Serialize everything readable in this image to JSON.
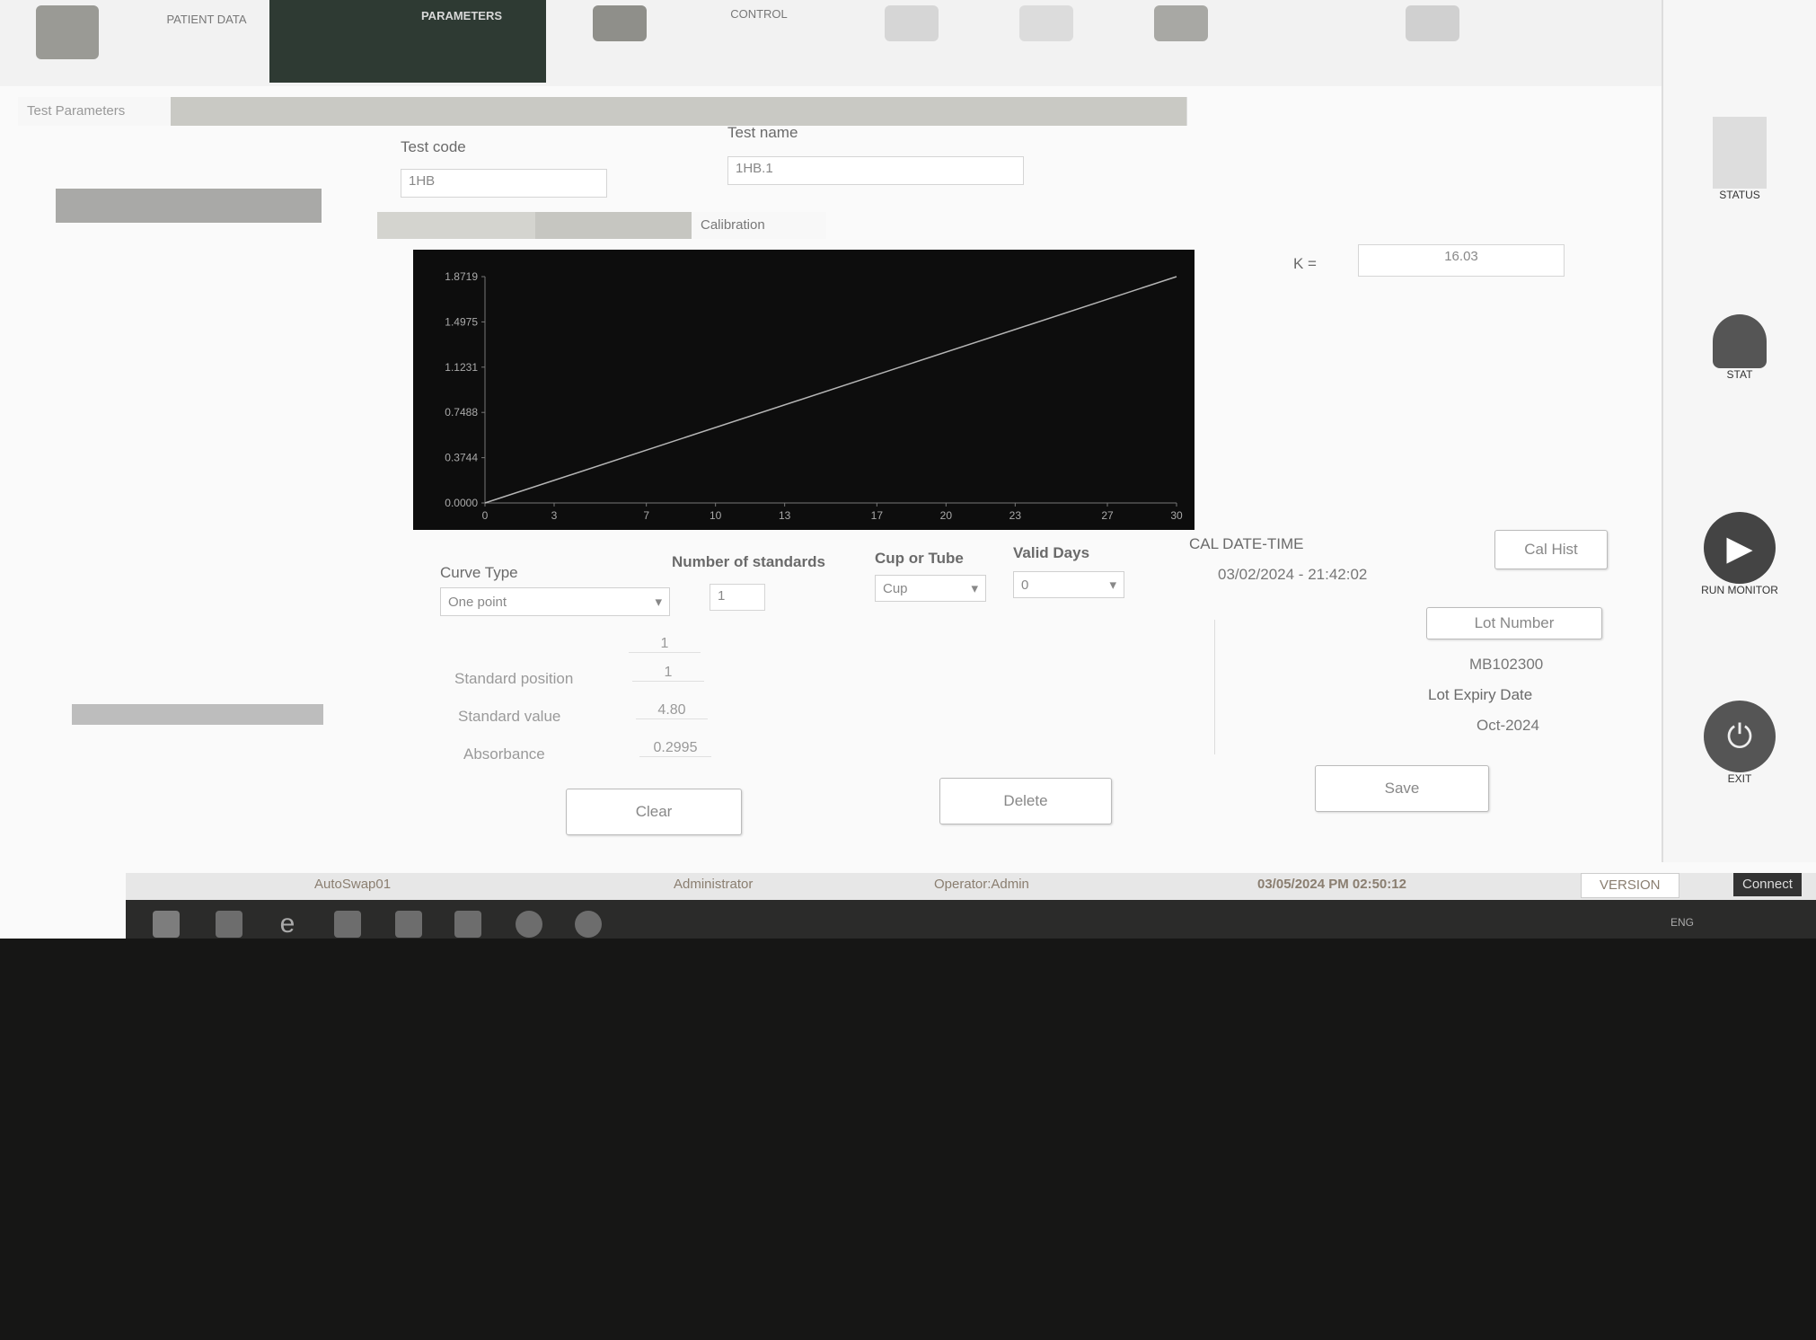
{
  "toolbar": {
    "items": [
      "PATIENT DATA",
      "PARAMETERS",
      "",
      "CONTROL",
      "",
      "",
      "",
      ""
    ]
  },
  "tabs": [
    "Test Parameters",
    "",
    "",
    "",
    "",
    "",
    "",
    "",
    ""
  ],
  "left_panel": {
    "tests": [
      "",
      "",
      "",
      "",
      "",
      "",
      "",
      "",
      "",
      "",
      "",
      "",
      "",
      "",
      "",
      "",
      "",
      "",
      "",
      "",
      "",
      "",
      "",
      "",
      "",
      "",
      "",
      "",
      ""
    ],
    "selected_index": 22
  },
  "test_code": {
    "label": "Test code",
    "value": "1HB"
  },
  "test_name": {
    "label": "Test name",
    "value": "1HB.1"
  },
  "subtabs": [
    "",
    "",
    "Calibration"
  ],
  "k": {
    "label": "K =",
    "value": "16.03"
  },
  "chart_data": {
    "type": "line",
    "y_ticks": [
      "0.0000",
      "0.3744",
      "0.7488",
      "1.1231",
      "1.4975",
      "1.8719"
    ],
    "x_ticks": [
      "0",
      "3",
      "7",
      "10",
      "13",
      "17",
      "20",
      "23",
      "27",
      "30"
    ],
    "ylim": [
      0,
      1.8719
    ],
    "xlim": [
      0,
      30
    ],
    "series": [
      {
        "x": [
          0,
          30
        ],
        "values": [
          0,
          1.8719
        ]
      }
    ],
    "line_color": "#b5b5b5",
    "background": "#0d0d0d"
  },
  "curve_type": {
    "label": "Curve Type",
    "value": "One point"
  },
  "num_standards": {
    "label": "Number of standards",
    "value": "1"
  },
  "cup_tube": {
    "label": "Cup or Tube",
    "value": "Cup"
  },
  "valid_days": {
    "label": "Valid Days",
    "value": "0"
  },
  "cal": {
    "label": "CAL DATE-TIME",
    "value": "03/02/2024 - 21:42:02"
  },
  "standards": {
    "column_header": "1",
    "position_label": "Standard position",
    "position_value": "1",
    "value_label": "Standard value",
    "value_value": "4.80",
    "absorbance_label": "Absorbance",
    "absorbance_value": "0.2995"
  },
  "buttons": {
    "cal_hist": "Cal Hist",
    "lot_number": "Lot Number",
    "clear": "Clear",
    "delete": "Delete",
    "save": "Save"
  },
  "lot": {
    "number": "MB102300",
    "expiry_label": "Lot Expiry Date",
    "expiry_value": "Oct-2024"
  },
  "status": {
    "user": "Administrator",
    "operator": "Operator:Admin",
    "datetime": "03/05/2024 PM 02:50:12",
    "version": "VERSION",
    "connect": "Connect",
    "left": "AutoSwap01"
  },
  "side": {
    "status": "STATUS",
    "stat": "STAT",
    "run_monitor": "RUN MONITOR",
    "exit": "EXIT"
  },
  "taskbar": {
    "lang": "ENG"
  }
}
